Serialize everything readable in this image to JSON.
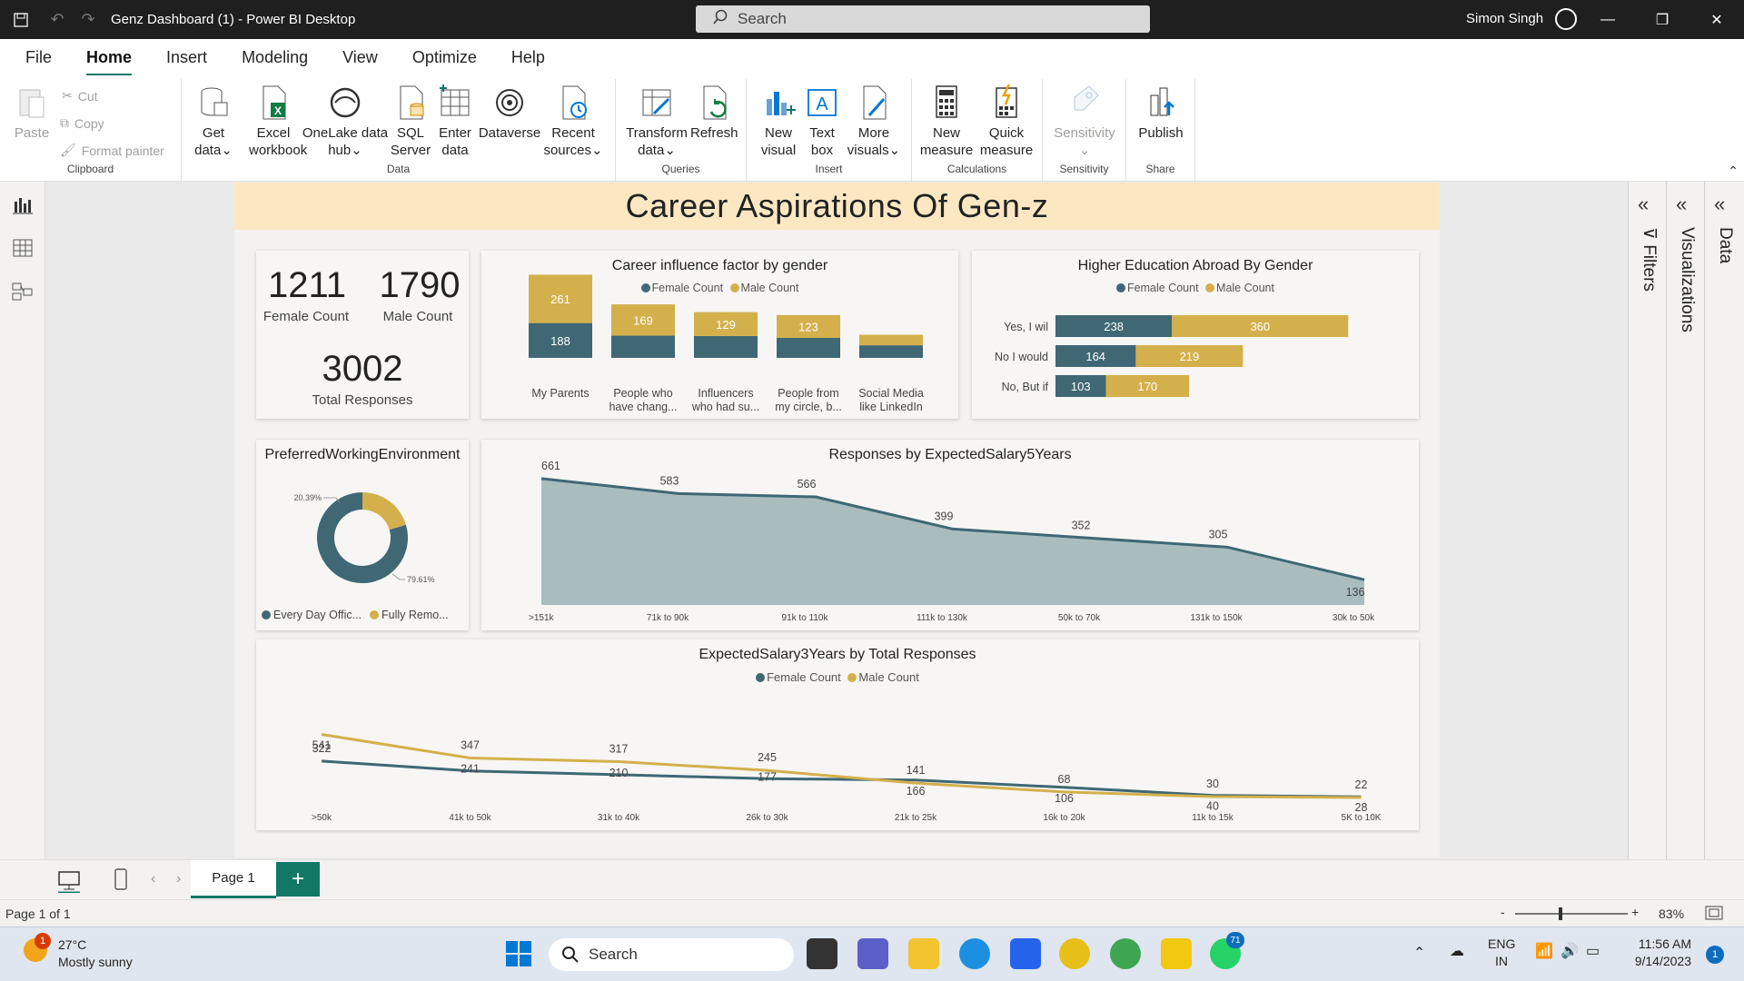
{
  "window": {
    "title": "Genz Dashboard (1) - Power BI Desktop",
    "search_placeholder": "Search",
    "user": "Simon Singh"
  },
  "menu": [
    "File",
    "Home",
    "Insert",
    "Modeling",
    "View",
    "Optimize",
    "Help"
  ],
  "ribbon": {
    "clipboard": {
      "paste": "Paste",
      "cut": "Cut",
      "copy": "Copy",
      "format_painter": "Format painter",
      "group": "Clipboard"
    },
    "data": {
      "get_data": [
        "Get",
        "data"
      ],
      "excel": [
        "Excel",
        "workbook"
      ],
      "onelake": [
        "OneLake data",
        "hub"
      ],
      "sql": [
        "SQL",
        "Server"
      ],
      "enter": [
        "Enter",
        "data"
      ],
      "dataverse": "Dataverse",
      "recent": [
        "Recent",
        "sources"
      ],
      "group": "Data"
    },
    "queries": {
      "transform": [
        "Transform",
        "data"
      ],
      "refresh": "Refresh",
      "group": "Queries"
    },
    "insert": {
      "new_visual": [
        "New",
        "visual"
      ],
      "text_box": [
        "Text",
        "box"
      ],
      "more_visuals": [
        "More",
        "visuals"
      ],
      "group": "Insert"
    },
    "calculations": {
      "new_measure": [
        "New",
        "measure"
      ],
      "quick_measure": [
        "Quick",
        "measure"
      ],
      "group": "Calculations"
    },
    "sensitivity": {
      "label": "Sensitivity",
      "group": "Sensitivity"
    },
    "share": {
      "publish": "Publish",
      "group": "Share"
    }
  },
  "report": {
    "banner": "Career Aspirations Of Gen-z",
    "kpis": [
      {
        "value": "1211",
        "label": "Female Count"
      },
      {
        "value": "1790",
        "label": "Male Count"
      },
      {
        "value": "3002",
        "label": "Total Responses"
      }
    ],
    "legend": {
      "female": "Female Count",
      "male": "Male Count"
    }
  },
  "colors": {
    "female": "#3f6874",
    "male": "#d4b04c",
    "accent": "#117865",
    "area": "#a9bdbe"
  },
  "chart_data": [
    {
      "type": "bar",
      "title": "Career influence factor by gender",
      "categories": [
        "My Parents",
        "People who have chang...",
        "Influencers who had su...",
        "People from my circle, b...",
        "Social Media like LinkedIn"
      ],
      "category_lines": [
        [
          "My Parents"
        ],
        [
          "People who",
          "have chang..."
        ],
        [
          "Influencers",
          "who had su..."
        ],
        [
          "People from",
          "my circle, b..."
        ],
        [
          "Social Media",
          "like LinkedIn"
        ]
      ],
      "stacked": true,
      "series": [
        {
          "name": "Female Count",
          "values": [
            188,
            120,
            118,
            108,
            68
          ],
          "labels": [
            "188",
            "",
            "",
            "",
            ""
          ]
        },
        {
          "name": "Male Count",
          "values": [
            261,
            169,
            129,
            123,
            57
          ],
          "labels": [
            "261",
            "169",
            "129",
            "123",
            ""
          ]
        }
      ],
      "legend": "top-center"
    },
    {
      "type": "bar",
      "orientation": "horizontal",
      "title": "Higher Education Abroad By Gender",
      "categories": [
        "Yes, I wil",
        "No I would",
        "No, But if"
      ],
      "stacked": true,
      "series": [
        {
          "name": "Female Count",
          "values": [
            238,
            164,
            103
          ]
        },
        {
          "name": "Male Count",
          "values": [
            360,
            219,
            170
          ]
        }
      ],
      "legend": "top-center"
    },
    {
      "type": "pie",
      "donut": true,
      "title": "PreferredWorkingEnvironment",
      "slices": [
        {
          "label": "Every Day Offic...",
          "value": 79.61,
          "display": "79.61%"
        },
        {
          "label": "Fully Remo...",
          "value": 20.39,
          "display": "20.39%"
        }
      ],
      "legend": "bottom"
    },
    {
      "type": "area",
      "title": "Responses by ExpectedSalary5Years",
      "categories": [
        ">151k",
        "71k to 90k",
        "91k to 110k",
        "111k to 130k",
        "50k to 70k",
        "131k to 150k",
        "30k to 50k"
      ],
      "values": [
        661,
        583,
        566,
        399,
        352,
        305,
        136
      ]
    },
    {
      "type": "line",
      "title": "ExpectedSalary3Years by Total Responses",
      "categories": [
        ">50k",
        "41k to 50k",
        "31k to 40k",
        "26k to 30k",
        "21k to 25k",
        "16k to 20k",
        "11k to 15k",
        "5K to 10K"
      ],
      "series": [
        {
          "name": "Female Count",
          "values": [
            322,
            241,
            210,
            177,
            166,
            106,
            40,
            28
          ]
        },
        {
          "name": "Male Count",
          "values": [
            541,
            347,
            317,
            245,
            141,
            68,
            30,
            22
          ]
        }
      ],
      "legend": "top-center"
    }
  ],
  "panes": {
    "filters": "Filters",
    "visualizations": "Visualizations",
    "data": "Data"
  },
  "pages": {
    "tab": "Page 1",
    "add": "+",
    "status": "Page 1 of 1",
    "zoom": "83%"
  },
  "taskbar": {
    "temp": "27°C",
    "weather": "Mostly sunny",
    "weather_badge": "1",
    "search": "Search",
    "lang1": "ENG",
    "lang2": "IN",
    "time": "11:56 AM",
    "date": "9/14/2023",
    "notif": "1",
    "whatsapp_badge": "71"
  }
}
